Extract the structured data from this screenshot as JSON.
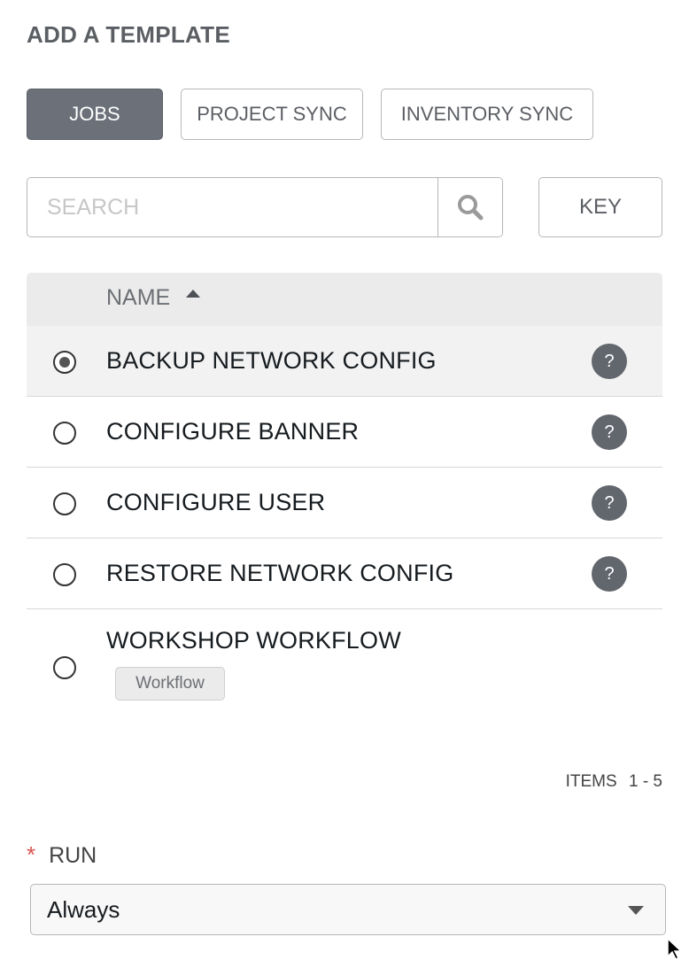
{
  "title": "ADD A TEMPLATE",
  "tabs": [
    {
      "label": "JOBS",
      "active": true
    },
    {
      "label": "PROJECT SYNC",
      "active": false
    },
    {
      "label": "INVENTORY SYNC",
      "active": false
    }
  ],
  "search": {
    "placeholder": "SEARCH",
    "icon": "search-icon"
  },
  "key_button": "KEY",
  "list": {
    "column_header": "NAME",
    "sort": "ascending",
    "rows": [
      {
        "name": "BACKUP NETWORK CONFIG",
        "selected": true,
        "help": "?"
      },
      {
        "name": "CONFIGURE BANNER",
        "selected": false,
        "help": "?"
      },
      {
        "name": "CONFIGURE USER",
        "selected": false,
        "help": "?"
      },
      {
        "name": "RESTORE NETWORK CONFIG",
        "selected": false,
        "help": "?"
      },
      {
        "name": "WORKSHOP WORKFLOW",
        "selected": false,
        "badge": "Workflow"
      }
    ]
  },
  "pagination": {
    "label": "ITEMS",
    "range": "1 - 5"
  },
  "run": {
    "required_marker": "*",
    "label": "RUN",
    "value": "Always"
  },
  "colors": {
    "active_tab": "#6c7079",
    "help_badge": "#62666d",
    "required": "#d9534f"
  }
}
